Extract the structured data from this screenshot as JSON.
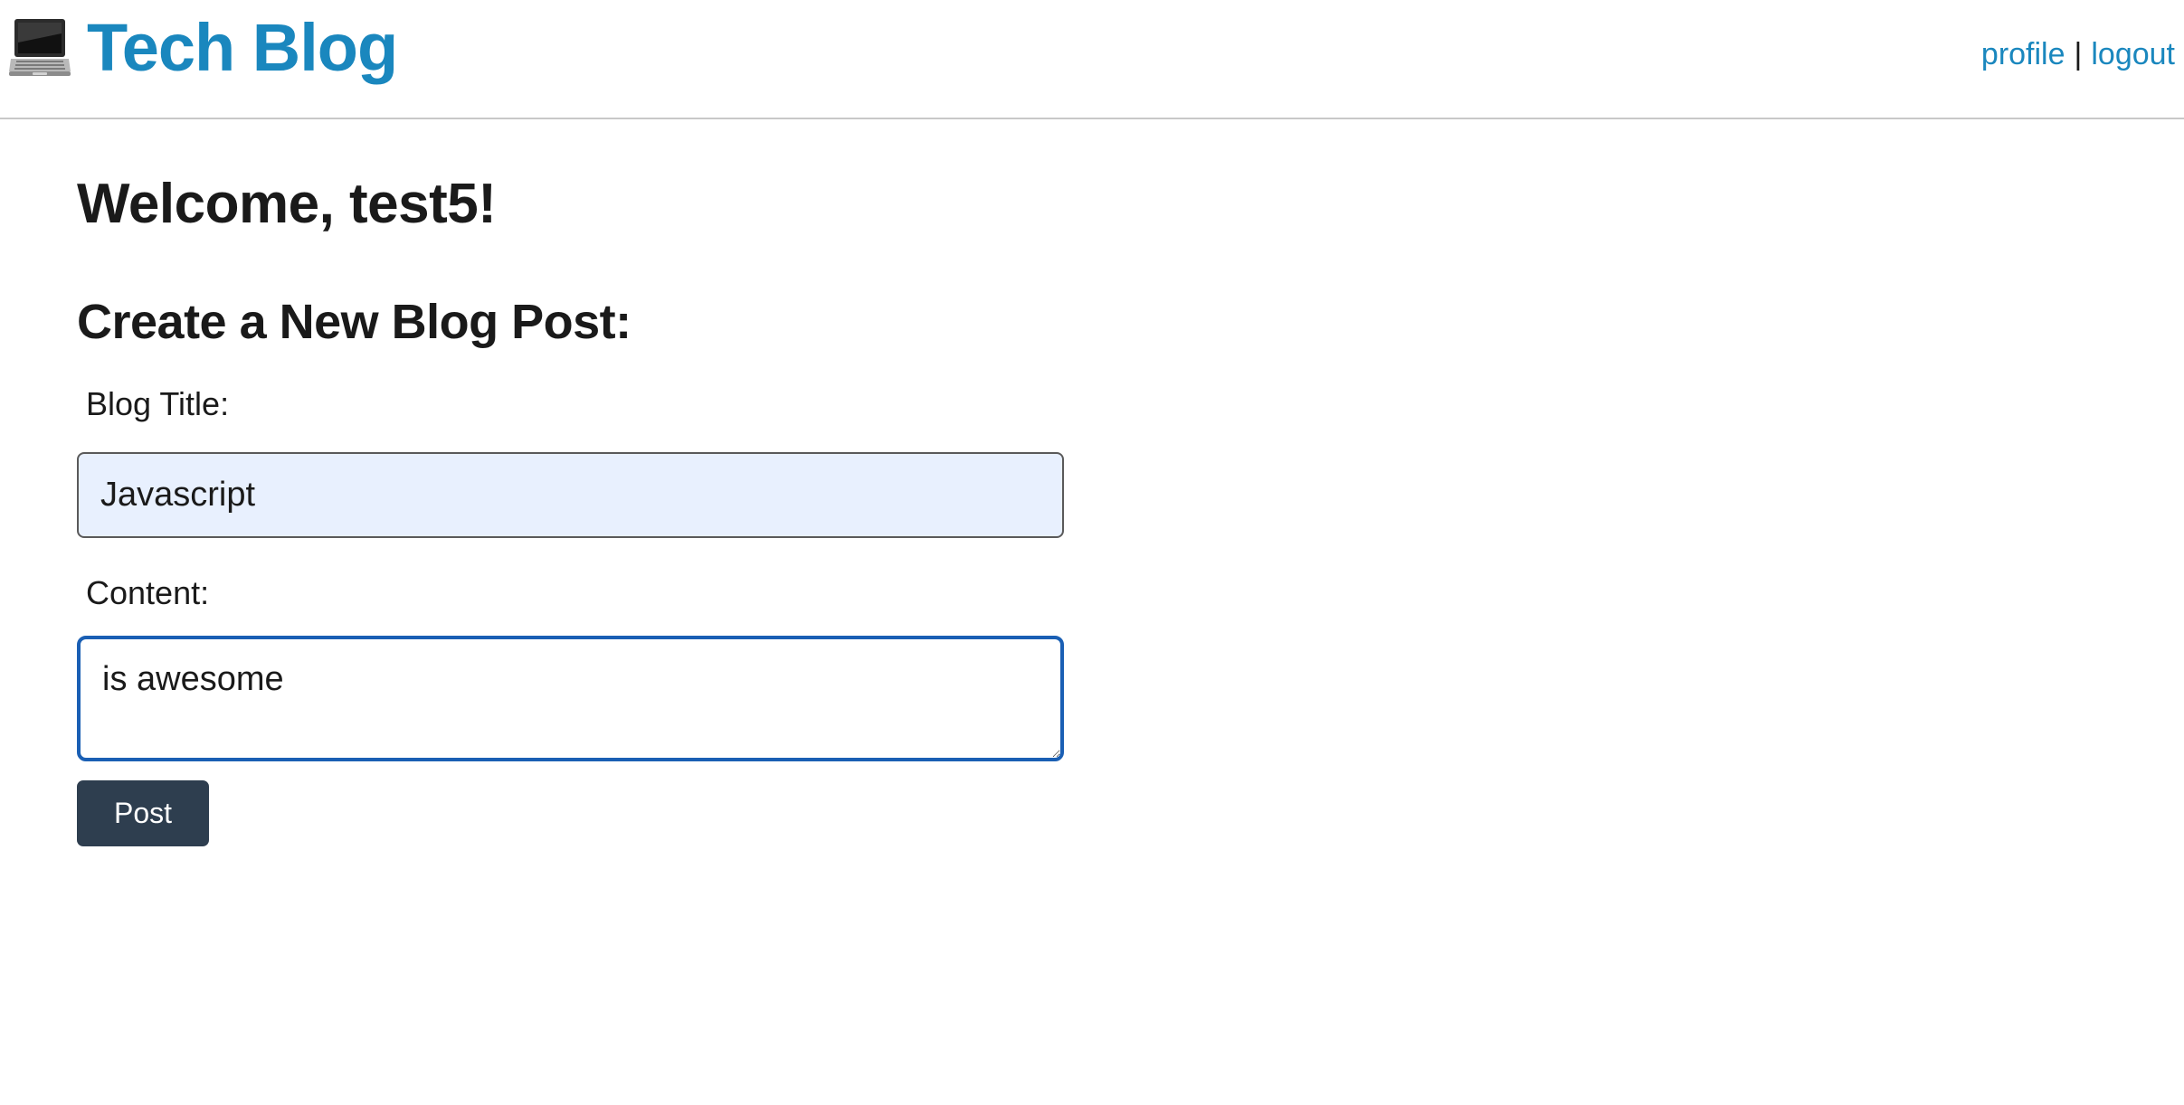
{
  "header": {
    "brand_icon": "laptop-icon",
    "brand_title": "Tech Blog",
    "nav": {
      "profile_label": "profile",
      "separator": "|",
      "logout_label": "logout"
    },
    "link_color": "#1a87be"
  },
  "main": {
    "welcome": "Welcome, test5!",
    "create_heading": "Create a New Blog Post:",
    "form": {
      "title_label": "Blog Title:",
      "title_value": "Javascript",
      "content_label": "Content:",
      "content_value": "is awesome",
      "submit_label": "Post"
    }
  },
  "colors": {
    "accent": "#1a87be",
    "button_bg": "#2e3e4f",
    "autofill_bg": "#e8f0fe",
    "focus_border": "#1a5fb4"
  }
}
